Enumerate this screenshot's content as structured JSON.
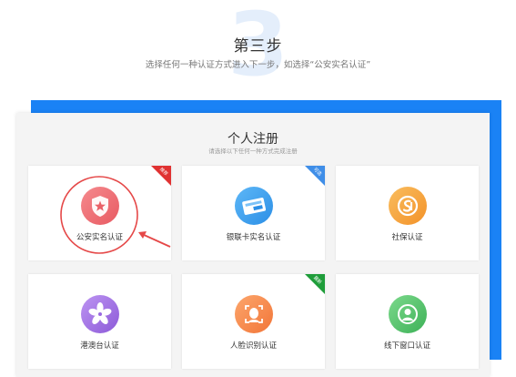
{
  "step": {
    "number": "3",
    "title": "第三步",
    "subtitle": "选择任何一种认证方式进入下一步，如选择“公安实名认证”"
  },
  "panel": {
    "title": "个人注册",
    "subtitle": "请选择以下任何一种方式完成注册"
  },
  "cards": [
    {
      "label": "公安实名认证",
      "badge": "推荐",
      "badge_color": "#e03232",
      "icon": "police-badge-icon",
      "color": "#ef6e73"
    },
    {
      "label": "银联卡实名认证",
      "badge": "可选",
      "badge_color": "#3f8ee8",
      "icon": "unionpay-card-icon",
      "color": "#3e9ef0"
    },
    {
      "label": "社保认证",
      "badge": "",
      "badge_color": "",
      "icon": "social-security-icon",
      "color": "#f6a43a"
    },
    {
      "label": "港澳台认证",
      "badge": "",
      "badge_color": "",
      "icon": "bauhinia-flower-icon",
      "color": "#a77be6"
    },
    {
      "label": "人脸识别认证",
      "badge": "最新",
      "badge_color": "#1f9d3a",
      "icon": "face-scan-icon",
      "color": "#f68a4c"
    },
    {
      "label": "线下窗口认证",
      "badge": "",
      "badge_color": "",
      "icon": "window-service-icon",
      "color": "#55c46e"
    }
  ],
  "accent_color": "#1a82f5"
}
